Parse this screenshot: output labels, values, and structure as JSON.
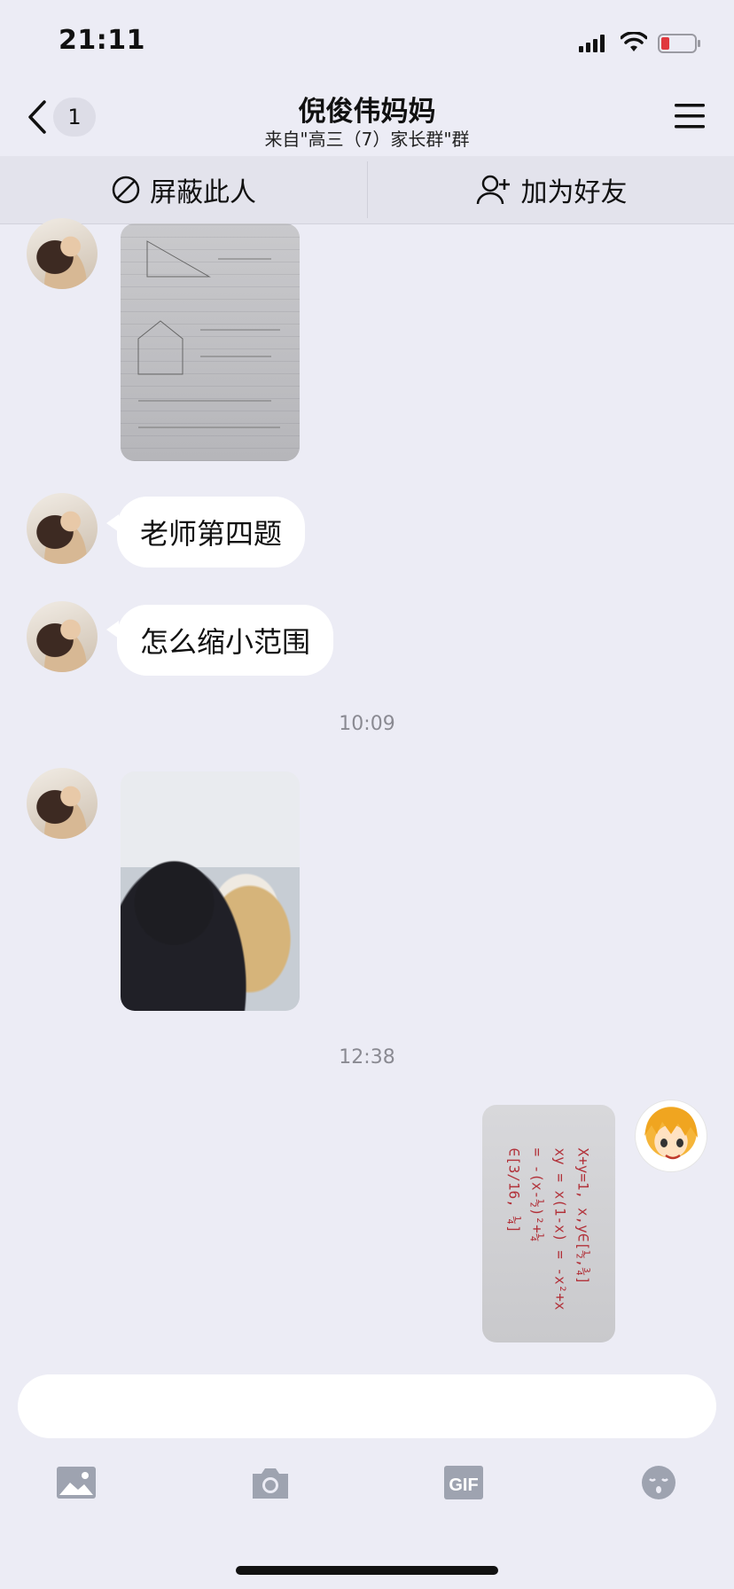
{
  "status_bar": {
    "time": "21:11"
  },
  "nav": {
    "unread_count": "1",
    "title": "倪俊伟妈妈",
    "subtitle": "来自\"高三（7）家长群\"群"
  },
  "actions": {
    "block_label": "屏蔽此人",
    "add_friend_label": "加为好友"
  },
  "messages": [
    {
      "type": "image",
      "sender": "other",
      "content": "photo of handwritten math notes"
    },
    {
      "type": "text",
      "sender": "other",
      "text": "老师第四题"
    },
    {
      "type": "text",
      "sender": "other",
      "text": "怎么缩小范围"
    },
    {
      "type": "timestamp",
      "text": "10:09"
    },
    {
      "type": "image",
      "sender": "other",
      "content": "photo of student studying"
    },
    {
      "type": "timestamp",
      "text": "12:38"
    },
    {
      "type": "image",
      "sender": "self",
      "content": "photo of red handwritten math"
    }
  ],
  "math_photo_text": "X+y=1, x,y∈[½,¾]\nxy = x(1-x) = -x²+x\n= -(x-½)²+¼\n∈[3/16, ¼]",
  "input": {
    "value": "",
    "placeholder": ""
  },
  "toolbar": [
    "image-icon",
    "camera-icon",
    "gif-icon",
    "emoji-icon"
  ],
  "colors": {
    "background": "#ececf5",
    "bubble": "#ffffff",
    "action_bar": "#e3e3ec",
    "battery_low": "#e0383e"
  }
}
